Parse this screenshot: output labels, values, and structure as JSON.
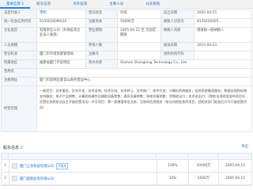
{
  "tabs": [
    "基本信息 1",
    "股东信息",
    "对外投资",
    "主要人员",
    "分支机构"
  ],
  "info": {
    "legal_rep_label": "法定代表人",
    "legal_rep": "李明",
    "reg_status_label": "登记状态",
    "reg_status": "存续",
    "est_date_label": "成立日期",
    "est_date": "2005-04-15",
    "credit_code_label": "统一社会信用代码",
    "credit_code": "91350200MA2X",
    "reg_capital_label": "注册资本",
    "reg_capital": "50000万",
    "tax_id_label": "纳税人识别号",
    "tax_id": "9135020005...",
    "taxpayer_label": "纳税人资质",
    "taxpayer": "增值税一般纳税人",
    "company_type_label": "企业类型",
    "company_type": "有限责任公司（外商投资企业法人独资）",
    "biz_term_label": "营业期限",
    "biz_term": "2005-04-15 至 无固定期限",
    "org_code_label": "组织机构代码",
    "org_code": "",
    "industry_label": "人员规模",
    "industry": "",
    "insured_label": "参保人数",
    "insured": "",
    "approve_date_label": "核准日期",
    "approve_date": "2015-04-23",
    "authority_label": "登记机关",
    "authority": "厦门市市场监督管理局",
    "reg_no_label": "注册号",
    "reg_no": "",
    "former_name_label": "曾用名",
    "former_name": "",
    "en_name_label": "英文名称",
    "en_name": "Xiamen Shanglong Technology Co., Ltd.",
    "region_label": "所属地区",
    "region": "福建省厦门市思明区",
    "address_label": "注册地址",
    "address": "厦门市思明区观音山商务营运中心",
    "scope_label": "经营范围",
    "scope": "一般项目：技术服务、技术开发、技术咨询、技术交流、技术转让、技术推广；软件开发；计算机系统服务；信息系统集成服务；数据处理和存储支持服务；电子产品销售；计算机软硬件及辅助设备零售；通讯设备销售；网络设备销售；货物进出口；技术进出口；（除依法须经批准的项目外，凭营业执照依法自主开展经营活动）许可项目：第一类增值电信业务；互联网信息服务（依法须经批准的项目，经相关部门批准后方可开展经营活动）"
  },
  "shareholders": {
    "title": "股东信息",
    "count": "2",
    "export_label": "导出",
    "rows": [
      {
        "idx": "1",
        "name": "厦门上龙科技有限公司",
        "tag": "大股东",
        "stake": "100%",
        "amount": "50000万",
        "date": "2005-04-15"
      },
      {
        "idx": "2",
        "name": "厦门国际投资有限公司",
        "tag": "",
        "stake": "10%",
        "amount": "5000万",
        "date": "2005-04-15"
      }
    ]
  }
}
